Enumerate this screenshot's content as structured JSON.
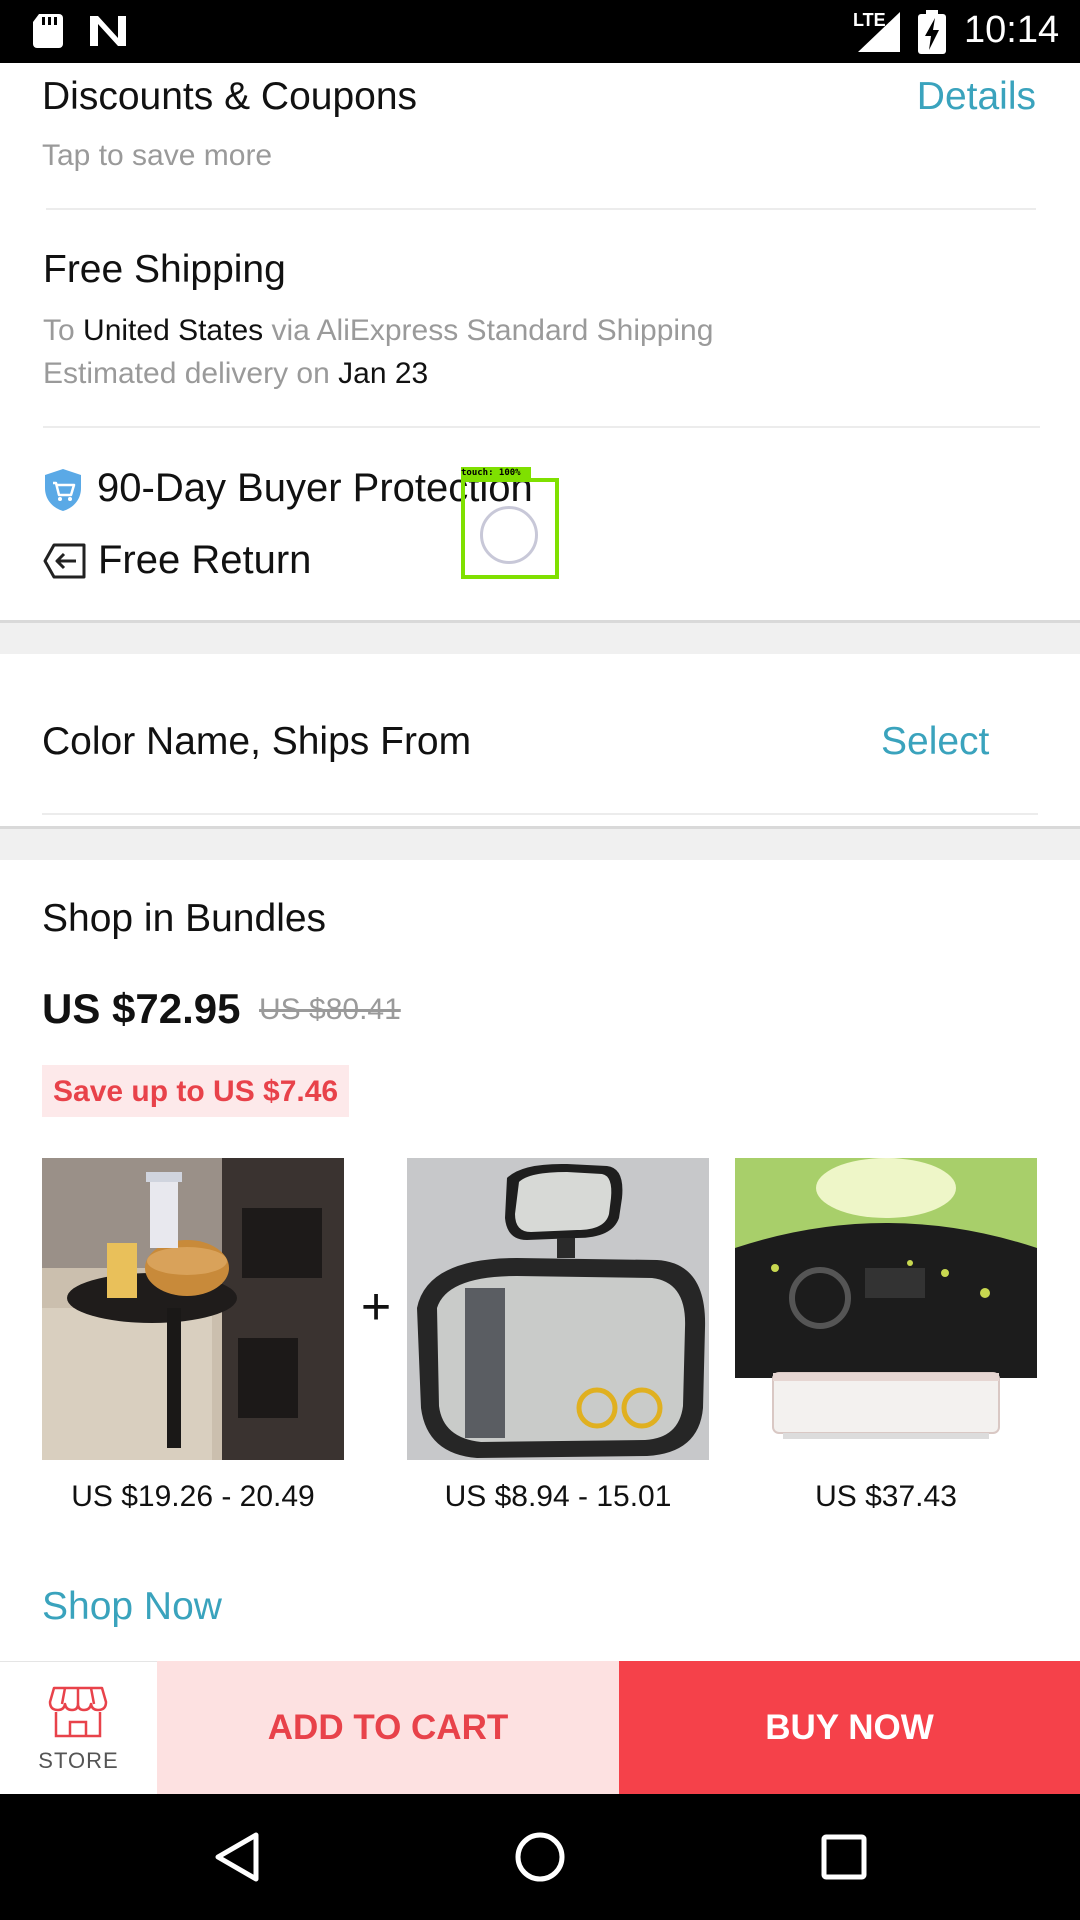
{
  "status_bar": {
    "network": "LTE",
    "time": "10:14"
  },
  "coupons": {
    "title": "Discounts & Coupons",
    "subtitle": "Tap to save more",
    "details_link": "Details"
  },
  "shipping": {
    "title": "Free Shipping",
    "to_prefix": "To",
    "country": "United States",
    "via_text": "via AliExpress Standard Shipping",
    "delivery_prefix": "Estimated delivery on",
    "delivery_date": "Jan 23"
  },
  "protection": {
    "buyer_protection": "90-Day Buyer Protection",
    "free_return": "Free Return",
    "touch_label": "touch: 100%"
  },
  "variant": {
    "label": "Color Name, Ships From",
    "select_link": "Select"
  },
  "bundles": {
    "title": "Shop in Bundles",
    "price": "US $72.95",
    "original_price": "US $80.41",
    "save_text": "Save up to US $7.46",
    "plus_sign": "+",
    "products": [
      {
        "price": "US $19.26 - 20.49"
      },
      {
        "price": "US $8.94 - 15.01"
      },
      {
        "price": "US $37.43"
      }
    ],
    "shop_now": "Shop Now"
  },
  "bottom_bar": {
    "store_label": "STORE",
    "add_to_cart": "ADD TO CART",
    "buy_now": "BUY NOW"
  },
  "colors": {
    "accent_link": "#3aa3bd",
    "sale_red": "#e8424a",
    "buy_bg": "#f5414a",
    "cart_bg": "#fde1e1"
  }
}
